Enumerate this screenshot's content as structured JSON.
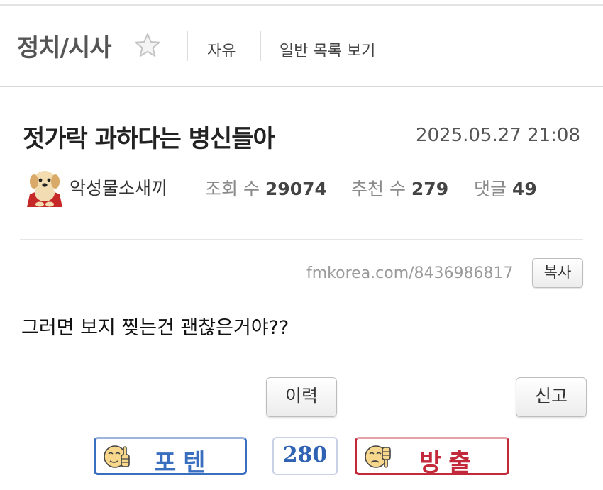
{
  "board": {
    "title": "정치/시사",
    "category": "자유",
    "list_link": "일반 목록 보기"
  },
  "post": {
    "title": "젓가락 과하다는 병신들아",
    "date": "2025.05.27 21:08",
    "author": "악성물소새끼",
    "views_label": "조회 수",
    "views": "29074",
    "recommend_label": "추천 수",
    "recommend": "279",
    "comments_label": "댓글",
    "comments": "49",
    "url": "fmkorea.com/8436986817",
    "copy_label": "복사",
    "body": "그러면 보지 찢는건 괜찮은거야??"
  },
  "actions": {
    "history_label": "이력",
    "report_label": "신고"
  },
  "votes": {
    "up_label": "포텐",
    "count": "280",
    "down_label": "방출"
  },
  "colors": {
    "up": "#3a6fc0",
    "down": "#c22a3c",
    "count": "#2f62b3"
  }
}
